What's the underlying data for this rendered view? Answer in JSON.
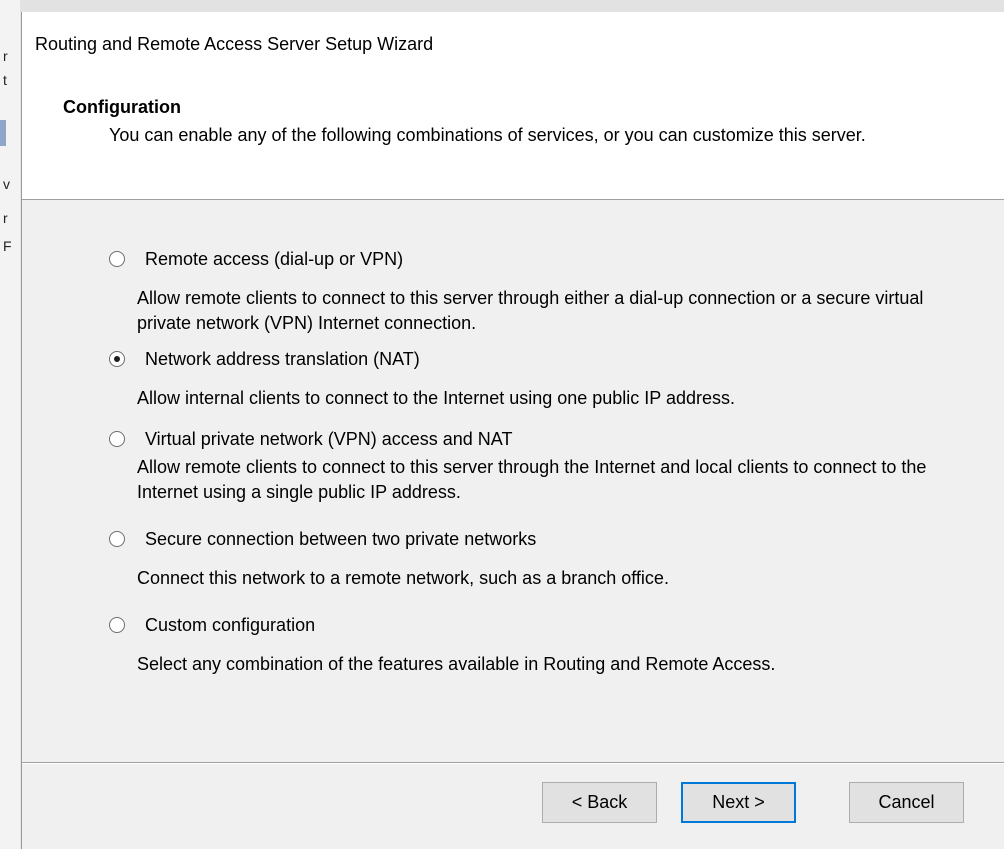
{
  "background": {
    "fragments": [
      "r",
      "t",
      "",
      "v",
      "r",
      "F"
    ]
  },
  "dialog": {
    "title": "Routing and Remote Access Server Setup Wizard",
    "heading": "Configuration",
    "subtitle": "You can enable any of the following combinations of services, or you can customize this server."
  },
  "options": [
    {
      "label": "Remote access (dial-up or VPN)",
      "description": "Allow remote clients to connect to this server through either a dial-up connection or a secure virtual private network (VPN) Internet connection.",
      "selected": false
    },
    {
      "label": "Network address translation (NAT)",
      "description": "Allow internal clients to connect to the Internet using one public IP address.",
      "selected": true
    },
    {
      "label": "Virtual private network (VPN) access and NAT",
      "description": "Allow remote clients to connect to this server through the Internet and local clients to connect to the Internet using a single public IP address.",
      "selected": false
    },
    {
      "label": "Secure connection between two private networks",
      "description": "Connect this network to a remote network, such as a branch office.",
      "selected": false
    },
    {
      "label": "Custom configuration",
      "description": "Select any combination of the features available in Routing and Remote Access.",
      "selected": false
    }
  ],
  "buttons": {
    "back": "< Back",
    "next": "Next >",
    "cancel": "Cancel"
  },
  "colors": {
    "accent": "#0078d7",
    "dialog_bg": "#f0f0f0",
    "header_bg": "#ffffff"
  }
}
